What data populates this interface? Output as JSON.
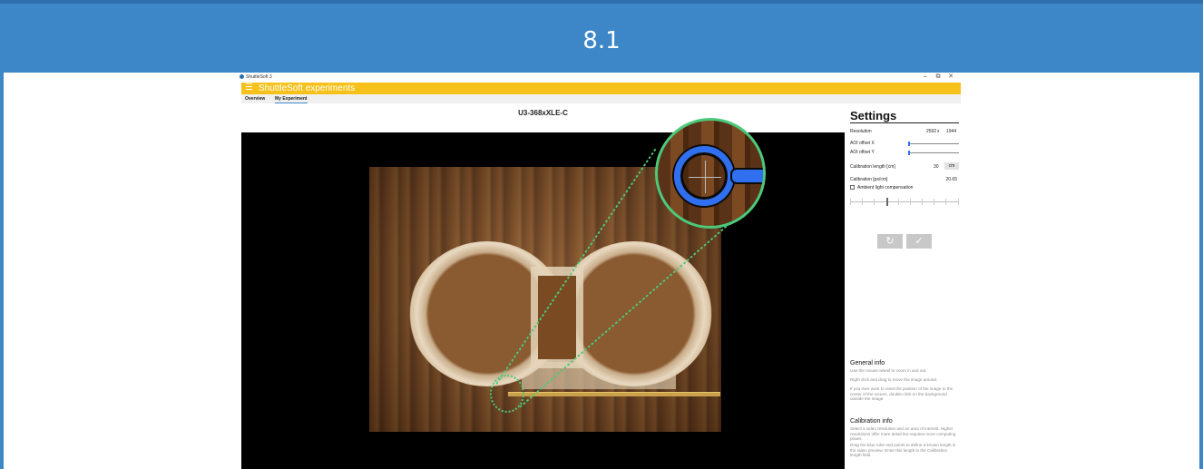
{
  "banner": {
    "title": "8.1"
  },
  "window": {
    "title": "ShuttleSoft 3",
    "controls": {
      "minimize": "–",
      "maximize": "⧉",
      "close": "✕"
    }
  },
  "appbar": {
    "menu_icon": "☰",
    "title": "ShuttleSoft experiments"
  },
  "tabs": [
    {
      "label": "Overview",
      "active": false
    },
    {
      "label": "My Experiment",
      "active": true
    }
  ],
  "camera": {
    "title": "U3-368xXLE-C"
  },
  "settings": {
    "title": "Settings",
    "resolution": {
      "label": "Resolution",
      "width": "2592",
      "separator": "x",
      "height": "1944"
    },
    "aoi_x": {
      "label": "AOI offset X",
      "value": 0
    },
    "aoi_y": {
      "label": "AOI offset Y",
      "value": 0
    },
    "calibration_length": {
      "label": "Calibration length [cm]",
      "value": "30",
      "unit": "cm"
    },
    "calibration": {
      "label": "Calibration [px/cm]",
      "value": "20.65"
    },
    "ambient": {
      "label": "Ambient light compensation",
      "checked": false
    },
    "reset_icon": "↻",
    "confirm_icon": "✓"
  },
  "general_info": {
    "title": "General info",
    "p1": "Use the mouse wheel to zoom in and out.",
    "p2": "Right click and drag to move the image around.",
    "p3": "If you ever want to reset the position of the image to the center of the screen, double-click on the background outside the image."
  },
  "calibration_info": {
    "title": "Calibration info",
    "p1": "Select a video resolution and an area of interest. Higher resolutions offer more detail but requires more computing power.",
    "p2": "Drag the blue ruler end points to define a known length in the video preview. Enter this length in the Calibration length field."
  },
  "colors": {
    "banner": "#3d86c8",
    "appbar": "#f5c11a",
    "accent": "#2f6ff0",
    "highlight": "#4cc97a"
  }
}
